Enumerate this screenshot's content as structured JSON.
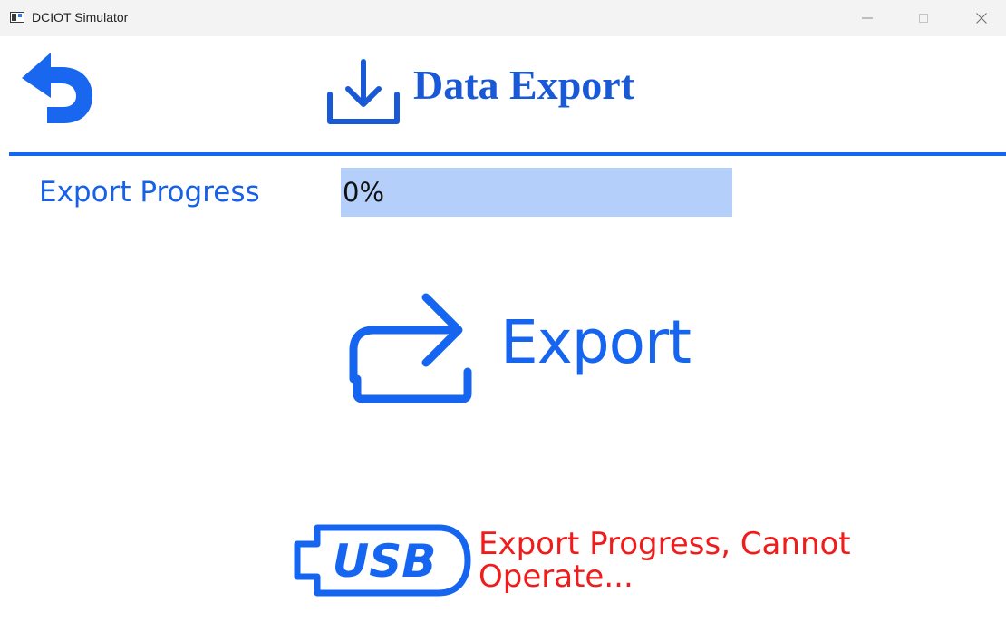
{
  "window": {
    "title": "DCIOT Simulator"
  },
  "header": {
    "title": "Data Export",
    "back_icon": "undo-arrow-icon",
    "title_icon": "download-tray-icon",
    "accent_color": "#1467f0"
  },
  "progress": {
    "label": "Export Progress",
    "value_text": "0%",
    "value": 0,
    "track_color": "#b5cffb"
  },
  "export": {
    "label": "Export",
    "icon": "share-forward-icon"
  },
  "usb": {
    "icon": "usb-icon",
    "status_text": "Export Progress, Cannot Operate...",
    "status_color": "#f01c1c"
  }
}
